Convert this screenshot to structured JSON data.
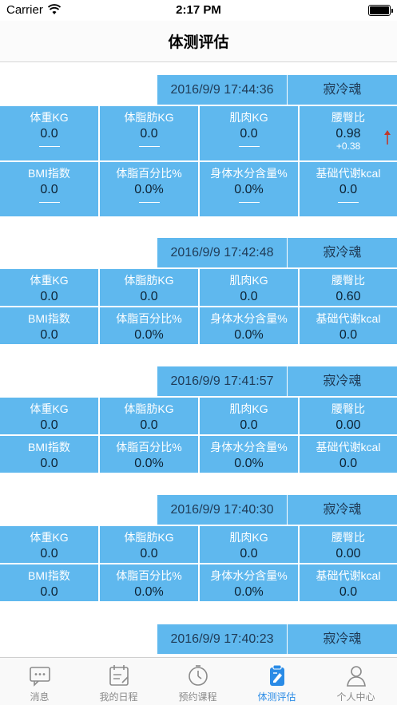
{
  "status_bar": {
    "carrier": "Carrier",
    "time": "2:17 PM"
  },
  "nav": {
    "title": "体测评估"
  },
  "labels": {
    "weight": "体重KG",
    "body_fat": "体脂肪KG",
    "muscle": "肌肉KG",
    "whr": "腰臀比",
    "bmi": "BMI指数",
    "fat_pct": "体脂百分比%",
    "water_pct": "身体水分含量%",
    "bmr": "基础代谢kcal"
  },
  "records": [
    {
      "date": "2016/9/9 17:44:36",
      "name": "寂冷魂",
      "weight": "0.0",
      "body_fat": "0.0",
      "muscle": "0.0",
      "whr": "0.98",
      "whr_delta": "+0.38",
      "bmi": "0.0",
      "fat_pct": "0.0%",
      "water_pct": "0.0%",
      "bmr": "0.0"
    },
    {
      "date": "2016/9/9 17:42:48",
      "name": "寂冷魂",
      "weight": "0.0",
      "body_fat": "0.0",
      "muscle": "0.0",
      "whr": "0.60",
      "bmi": "0.0",
      "fat_pct": "0.0%",
      "water_pct": "0.0%",
      "bmr": "0.0"
    },
    {
      "date": "2016/9/9 17:41:57",
      "name": "寂冷魂",
      "weight": "0.0",
      "body_fat": "0.0",
      "muscle": "0.0",
      "whr": "0.00",
      "bmi": "0.0",
      "fat_pct": "0.0%",
      "water_pct": "0.0%",
      "bmr": "0.0"
    },
    {
      "date": "2016/9/9 17:40:30",
      "name": "寂冷魂",
      "weight": "0.0",
      "body_fat": "0.0",
      "muscle": "0.0",
      "whr": "0.00",
      "bmi": "0.0",
      "fat_pct": "0.0%",
      "water_pct": "0.0%",
      "bmr": "0.0"
    },
    {
      "date": "2016/9/9 17:40:23",
      "name": "寂冷魂"
    }
  ],
  "tabs": [
    {
      "label": "消息",
      "icon": "chat-icon"
    },
    {
      "label": "我的日程",
      "icon": "calendar-icon"
    },
    {
      "label": "预约课程",
      "icon": "stopwatch-icon"
    },
    {
      "label": "体测评估",
      "icon": "assessment-icon",
      "active": true
    },
    {
      "label": "个人中心",
      "icon": "user-icon"
    }
  ],
  "colors": {
    "accent_blue": "#5fb8ee",
    "active_tab": "#2a8be6",
    "up_arrow": "#c0392b"
  }
}
